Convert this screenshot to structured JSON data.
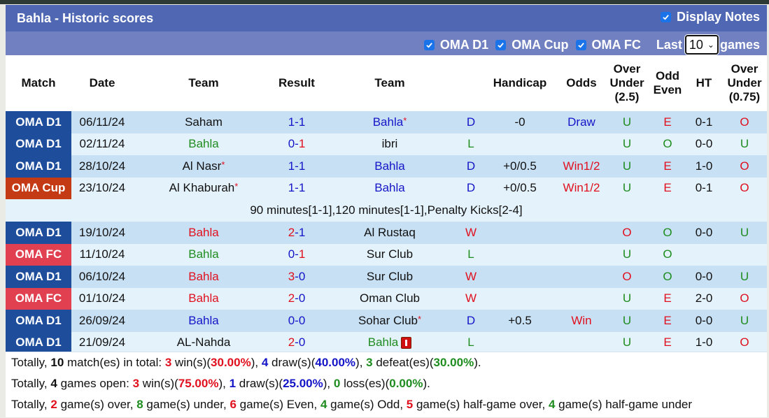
{
  "header": {
    "title": "Bahla - Historic scores",
    "display_notes_label": "Display Notes",
    "display_notes_checked": true
  },
  "filters": {
    "items": [
      {
        "label": "OMA D1",
        "checked": true
      },
      {
        "label": "OMA Cup",
        "checked": true
      },
      {
        "label": "OMA FC",
        "checked": true
      }
    ],
    "last_label": "Last",
    "last_value": "10",
    "games_label": "games"
  },
  "columns": [
    "Match",
    "Date",
    "Team",
    "Result",
    "Team",
    "",
    "Handicap",
    "Odds",
    "Over Under (2.5)",
    "Odd Even",
    "HT",
    "Over Under (0.75)"
  ],
  "colors": {
    "header_dark": "#5068b4",
    "header_light": "#7080c0",
    "league_d1": "#1e4d9c",
    "league_cup": "#c33a14",
    "league_fc": "#e0404f",
    "row_odd": "#c8e0f4",
    "row_even": "#e4f2fb",
    "red": "#e0101e",
    "blue": "#1515c8",
    "green": "#1e8c1e"
  },
  "rows": [
    {
      "league": "OMA D1",
      "league_type": "d1",
      "date": "06/11/24",
      "home": "Saham",
      "home_color": "black",
      "home_star": false,
      "score_h": "1",
      "score_a": "1",
      "score_h_color": "blue",
      "score_a_color": "blue",
      "away": "Bahla",
      "away_color": "blue",
      "away_star": true,
      "away_redcard": false,
      "wl": "D",
      "wl_color": "blue",
      "handicap": "-0",
      "odds": "Draw",
      "odds_color": "blue",
      "ou": "U",
      "ou_color": "green",
      "oe": "E",
      "oe_color": "red",
      "ht": "0-1",
      "ou2": "O",
      "ou2_color": "red"
    },
    {
      "league": "OMA D1",
      "league_type": "d1",
      "date": "02/11/24",
      "home": "Bahla",
      "home_color": "green",
      "home_star": false,
      "score_h": "0",
      "score_a": "1",
      "score_h_color": "blue",
      "score_a_color": "red",
      "away": "ibri",
      "away_color": "black",
      "away_star": false,
      "away_redcard": false,
      "wl": "L",
      "wl_color": "green",
      "handicap": "",
      "odds": "",
      "odds_color": "black",
      "ou": "U",
      "ou_color": "green",
      "oe": "O",
      "oe_color": "green",
      "ht": "0-0",
      "ou2": "U",
      "ou2_color": "green"
    },
    {
      "league": "OMA D1",
      "league_type": "d1",
      "date": "28/10/24",
      "home": "Al Nasr",
      "home_color": "black",
      "home_star": true,
      "score_h": "1",
      "score_a": "1",
      "score_h_color": "blue",
      "score_a_color": "blue",
      "away": "Bahla",
      "away_color": "blue",
      "away_star": false,
      "away_redcard": false,
      "wl": "D",
      "wl_color": "blue",
      "handicap": "+0/0.5",
      "odds": "Win1/2",
      "odds_color": "red",
      "ou": "U",
      "ou_color": "green",
      "oe": "E",
      "oe_color": "red",
      "ht": "1-0",
      "ou2": "O",
      "ou2_color": "red"
    },
    {
      "league": "OMA Cup",
      "league_type": "cup",
      "date": "23/10/24",
      "home": "Al Khaburah",
      "home_color": "black",
      "home_star": true,
      "score_h": "1",
      "score_a": "1",
      "score_h_color": "blue",
      "score_a_color": "blue",
      "away": "Bahla",
      "away_color": "blue",
      "away_star": false,
      "away_redcard": false,
      "wl": "D",
      "wl_color": "blue",
      "handicap": "+0/0.5",
      "odds": "Win1/2",
      "odds_color": "red",
      "ou": "U",
      "ou_color": "green",
      "oe": "E",
      "oe_color": "red",
      "ht": "0-1",
      "ou2": "O",
      "ou2_color": "red",
      "note": "90 minutes[1-1],120 minutes[1-1],Penalty Kicks[2-4]"
    },
    {
      "league": "OMA D1",
      "league_type": "d1",
      "date": "19/10/24",
      "home": "Bahla",
      "home_color": "red",
      "home_star": false,
      "score_h": "2",
      "score_a": "1",
      "score_h_color": "red",
      "score_a_color": "blue",
      "away": "Al Rustaq",
      "away_color": "black",
      "away_star": false,
      "away_redcard": false,
      "wl": "W",
      "wl_color": "red",
      "handicap": "",
      "odds": "",
      "odds_color": "black",
      "ou": "O",
      "ou_color": "red",
      "oe": "O",
      "oe_color": "green",
      "ht": "0-0",
      "ou2": "U",
      "ou2_color": "green"
    },
    {
      "league": "OMA FC",
      "league_type": "fc",
      "date": "11/10/24",
      "home": "Bahla",
      "home_color": "green",
      "home_star": false,
      "score_h": "0",
      "score_a": "1",
      "score_h_color": "blue",
      "score_a_color": "red",
      "away": "Sur Club",
      "away_color": "black",
      "away_star": false,
      "away_redcard": false,
      "wl": "L",
      "wl_color": "green",
      "handicap": "",
      "odds": "",
      "odds_color": "black",
      "ou": "U",
      "ou_color": "green",
      "oe": "O",
      "oe_color": "green",
      "ht": "",
      "ou2": "",
      "ou2_color": "black"
    },
    {
      "league": "OMA D1",
      "league_type": "d1",
      "date": "06/10/24",
      "home": "Bahla",
      "home_color": "red",
      "home_star": false,
      "score_h": "3",
      "score_a": "0",
      "score_h_color": "red",
      "score_a_color": "blue",
      "away": "Sur Club",
      "away_color": "black",
      "away_star": false,
      "away_redcard": false,
      "wl": "W",
      "wl_color": "red",
      "handicap": "",
      "odds": "",
      "odds_color": "black",
      "ou": "O",
      "ou_color": "red",
      "oe": "O",
      "oe_color": "green",
      "ht": "0-0",
      "ou2": "U",
      "ou2_color": "green"
    },
    {
      "league": "OMA FC",
      "league_type": "fc",
      "date": "01/10/24",
      "home": "Bahla",
      "home_color": "red",
      "home_star": false,
      "score_h": "2",
      "score_a": "0",
      "score_h_color": "red",
      "score_a_color": "blue",
      "away": "Oman Club",
      "away_color": "black",
      "away_star": false,
      "away_redcard": false,
      "wl": "W",
      "wl_color": "red",
      "handicap": "",
      "odds": "",
      "odds_color": "black",
      "ou": "U",
      "ou_color": "green",
      "oe": "E",
      "oe_color": "red",
      "ht": "2-0",
      "ou2": "O",
      "ou2_color": "red"
    },
    {
      "league": "OMA D1",
      "league_type": "d1",
      "date": "26/09/24",
      "home": "Bahla",
      "home_color": "blue",
      "home_star": false,
      "score_h": "0",
      "score_a": "0",
      "score_h_color": "blue",
      "score_a_color": "blue",
      "away": "Sohar Club",
      "away_color": "black",
      "away_star": true,
      "away_redcard": false,
      "wl": "D",
      "wl_color": "blue",
      "handicap": "+0.5",
      "odds": "Win",
      "odds_color": "red",
      "ou": "U",
      "ou_color": "green",
      "oe": "E",
      "oe_color": "red",
      "ht": "0-0",
      "ou2": "U",
      "ou2_color": "green"
    },
    {
      "league": "OMA D1",
      "league_type": "d1",
      "date": "21/09/24",
      "home": "AL-Nahda",
      "home_color": "black",
      "home_star": false,
      "score_h": "2",
      "score_a": "0",
      "score_h_color": "red",
      "score_a_color": "blue",
      "away": "Bahla",
      "away_color": "green",
      "away_star": false,
      "away_redcard": true,
      "wl": "L",
      "wl_color": "green",
      "handicap": "",
      "odds": "",
      "odds_color": "black",
      "ou": "U",
      "ou_color": "green",
      "oe": "E",
      "oe_color": "red",
      "ht": "1-0",
      "ou2": "O",
      "ou2_color": "red"
    }
  ],
  "summary": [
    [
      {
        "t": "Totally, ",
        "c": "black",
        "b": false
      },
      {
        "t": "10",
        "c": "black",
        "b": true
      },
      {
        "t": " match(es) in total: ",
        "c": "black",
        "b": false
      },
      {
        "t": "3",
        "c": "red",
        "b": true
      },
      {
        "t": " win(s)(",
        "c": "black",
        "b": false
      },
      {
        "t": "30.00%",
        "c": "red",
        "b": true
      },
      {
        "t": "), ",
        "c": "black",
        "b": false
      },
      {
        "t": "4",
        "c": "blue",
        "b": true
      },
      {
        "t": " draw(s)(",
        "c": "black",
        "b": false
      },
      {
        "t": "40.00%",
        "c": "blue",
        "b": true
      },
      {
        "t": "), ",
        "c": "black",
        "b": false
      },
      {
        "t": "3",
        "c": "green",
        "b": true
      },
      {
        "t": " defeat(es)(",
        "c": "black",
        "b": false
      },
      {
        "t": "30.00%",
        "c": "green",
        "b": true
      },
      {
        "t": ").",
        "c": "black",
        "b": false
      }
    ],
    [
      {
        "t": "Totally, ",
        "c": "black",
        "b": false
      },
      {
        "t": "4",
        "c": "black",
        "b": true
      },
      {
        "t": " games open: ",
        "c": "black",
        "b": false
      },
      {
        "t": "3",
        "c": "red",
        "b": true
      },
      {
        "t": " win(s)(",
        "c": "black",
        "b": false
      },
      {
        "t": "75.00%",
        "c": "red",
        "b": true
      },
      {
        "t": "), ",
        "c": "black",
        "b": false
      },
      {
        "t": "1",
        "c": "blue",
        "b": true
      },
      {
        "t": " draw(s)(",
        "c": "black",
        "b": false
      },
      {
        "t": "25.00%",
        "c": "blue",
        "b": true
      },
      {
        "t": "), ",
        "c": "black",
        "b": false
      },
      {
        "t": "0",
        "c": "green",
        "b": true
      },
      {
        "t": " loss(es)(",
        "c": "black",
        "b": false
      },
      {
        "t": "0.00%",
        "c": "green",
        "b": true
      },
      {
        "t": ").",
        "c": "black",
        "b": false
      }
    ],
    [
      {
        "t": "Totally, ",
        "c": "black",
        "b": false
      },
      {
        "t": "2",
        "c": "red",
        "b": true
      },
      {
        "t": " game(s) over, ",
        "c": "black",
        "b": false
      },
      {
        "t": "8",
        "c": "green",
        "b": true
      },
      {
        "t": " game(s) under, ",
        "c": "black",
        "b": false
      },
      {
        "t": "6",
        "c": "red",
        "b": true
      },
      {
        "t": " game(s) Even, ",
        "c": "black",
        "b": false
      },
      {
        "t": "4",
        "c": "green",
        "b": true
      },
      {
        "t": " game(s) Odd, ",
        "c": "black",
        "b": false
      },
      {
        "t": "5",
        "c": "red",
        "b": true
      },
      {
        "t": " game(s) half-game over, ",
        "c": "black",
        "b": false
      },
      {
        "t": "4",
        "c": "green",
        "b": true
      },
      {
        "t": " game(s) half-game under",
        "c": "black",
        "b": false
      }
    ]
  ]
}
